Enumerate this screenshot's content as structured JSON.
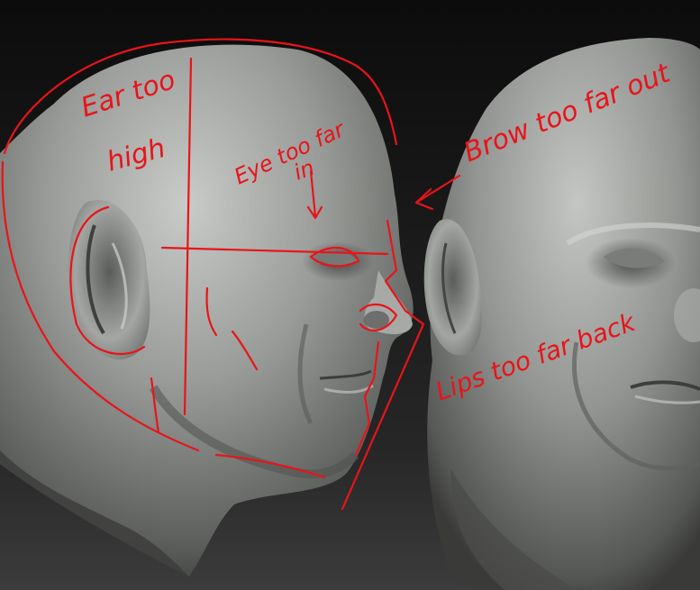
{
  "annotations": {
    "ear": {
      "line1": "Ear too",
      "line2": "high"
    },
    "eye": {
      "line1": "Eye too far",
      "line2": "in"
    },
    "brow": {
      "text": "Brow too far out"
    },
    "lips": {
      "text": "Lips too far back"
    }
  },
  "colors": {
    "background_top": "#0c0c0c",
    "background_bottom": "#3a3a3a",
    "skin_light": "#b4b6b3",
    "skin_mid": "#8a8c89",
    "skin_dark": "#3f403e",
    "annotation_red": "#e8141a"
  }
}
